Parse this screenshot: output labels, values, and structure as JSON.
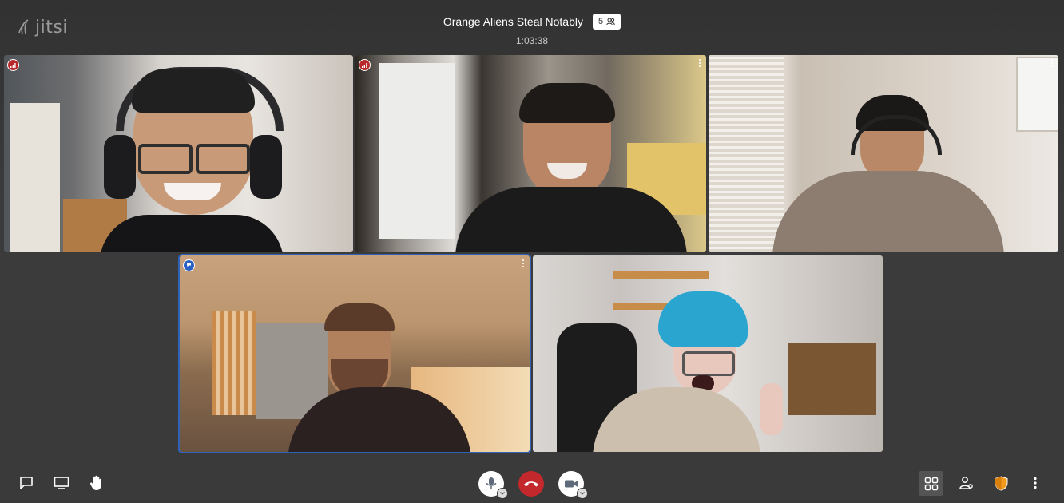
{
  "app": {
    "logo_text": "jitsi"
  },
  "header": {
    "title": "Orange Aliens Steal Notably",
    "participant_count": "5",
    "timer": "1:03:38"
  },
  "tiles": [
    {
      "indicator": "connection-red"
    },
    {
      "indicator": "connection-red",
      "menu": true
    },
    {
      "menu": true
    },
    {
      "indicator": "dominant-speaker-blue",
      "menu": true,
      "active": true
    },
    {}
  ],
  "toolbar": {
    "left": [
      "chat-icon",
      "screenshare-icon",
      "raise-hand-icon"
    ],
    "center": [
      "microphone-icon",
      "hangup-icon",
      "camera-icon"
    ],
    "right": [
      "tile-view-icon",
      "invite-icon",
      "security-shield-icon",
      "more-icon"
    ]
  },
  "colors": {
    "hangup": "#c3282c",
    "active_border": "#2f63b8",
    "shield": "#f29a1c",
    "background": "#3a3a3a"
  }
}
